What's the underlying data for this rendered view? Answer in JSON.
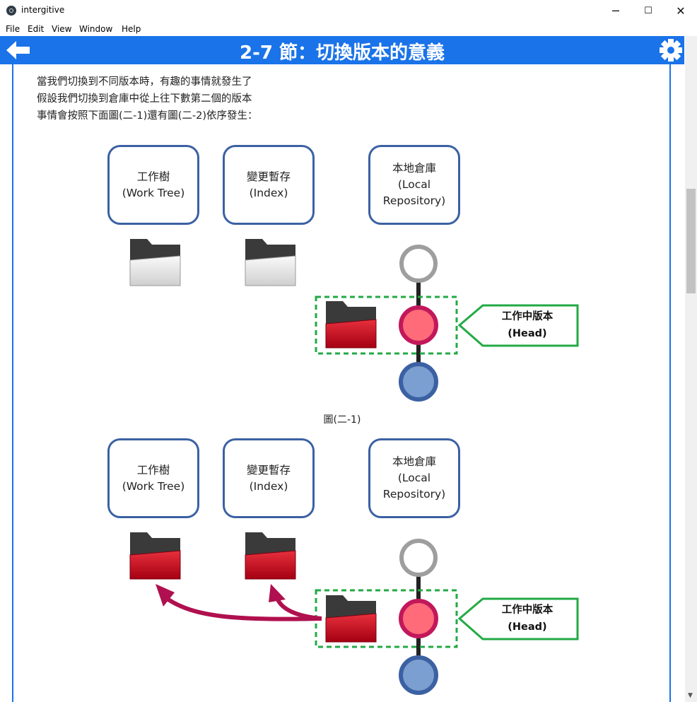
{
  "window": {
    "title": "intergitive",
    "minimize_glyph": "─",
    "maximize_glyph": "☐",
    "close_glyph": "✕"
  },
  "menu": [
    "File",
    "Edit",
    "View",
    "Window",
    "Help"
  ],
  "header": {
    "title": "2-7 節：切換版本的意義",
    "back_icon": "arrow-left-icon",
    "settings_icon": "gear-icon",
    "color": "#1a73e8"
  },
  "intro": [
    "當我們切換到不同版本時，有趣的事情就發生了",
    "假設我們切換到倉庫中從上往下數第二個的版本",
    "事情會按照下面圖(二-1)還有圖(二-2)依序發生："
  ],
  "figure1": {
    "work_tree": [
      "工作樹",
      "(Work Tree)"
    ],
    "index": [
      "變更暫存",
      "(Index)"
    ],
    "repo": [
      "本地倉庫",
      "(Local",
      "Repository)"
    ],
    "head_label": [
      "工作中版本",
      "(Head)"
    ],
    "caption": "圖(二-1)"
  },
  "figure2": {
    "work_tree": [
      "工作樹",
      "(Work Tree)"
    ],
    "index": [
      "變更暫存",
      "(Index)"
    ],
    "repo": [
      "本地倉庫",
      "(Local",
      "Repository)"
    ],
    "head_label": [
      "工作中版本",
      "(Head)"
    ]
  },
  "colors": {
    "box_border": "#3b61a3",
    "commit_empty": "#9e9e9e",
    "commit_head_fill": "#ff6b78",
    "commit_head_border": "#c2185b",
    "commit_blue_fill": "#7a9fd0",
    "commit_blue_border": "#3b61a3",
    "dashed_green": "#22aa44",
    "arrow": "#c2185b"
  }
}
